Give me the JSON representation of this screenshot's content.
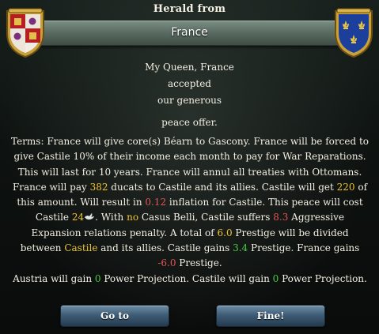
{
  "dialog": {
    "title": "Herald from",
    "country": "France",
    "message_lines": [
      "My Queen, France",
      "accepted",
      "our generous",
      "peace offer."
    ]
  },
  "terms": {
    "t1": "Terms: France will give core(s) Béarn to Gascony. France will be forced to give Castile 10% of their income each month to pay for War Reparations. This will last for 10 years. France will annul all treaties with Ottomans. France will pay ",
    "ducats": "382",
    "t2": " ducats to Castile and its allies. Castile will get ",
    "castile_share": "220",
    "t3": " of this amount. Will result in ",
    "inflation": "0.12",
    "t4": " inflation for Castile. This peace will cost Castile ",
    "peace_cost": "24",
    "t5": ". With ",
    "casus_belli": "no",
    "t6": " Casus Belli, Castile suffers ",
    "aggressive_expansion": "8.3",
    "t7": " Aggressive Expansion relations penalty. A total of ",
    "prestige_total": "6.0",
    "t8": " Prestige will be divided between ",
    "castile": "Castile",
    "t9": " and its allies. Castile gains ",
    "castile_prestige": "3.4",
    "t10": " Prestige. France gains ",
    "france_prestige": "-6.0",
    "t11": " Prestige.",
    "t12": "Austria will gain ",
    "austria_pp": "0",
    "t13": " Power Projection. Castile will gain ",
    "castile_pp": "0",
    "t14": " Power Projection."
  },
  "buttons": {
    "goto_label": "Go to",
    "fine_label": "Fine!"
  },
  "colors": {
    "highlight_yellow": "#f0c431",
    "negative_red": "#e25555",
    "positive_green": "#49cc45",
    "banner": "#5b6d63",
    "button": "#3f5d76"
  },
  "icons": {
    "left_shield": "castile-coat-of-arms-icon",
    "right_shield": "france-fleur-de-lis-icon",
    "dove": "dove-icon"
  }
}
